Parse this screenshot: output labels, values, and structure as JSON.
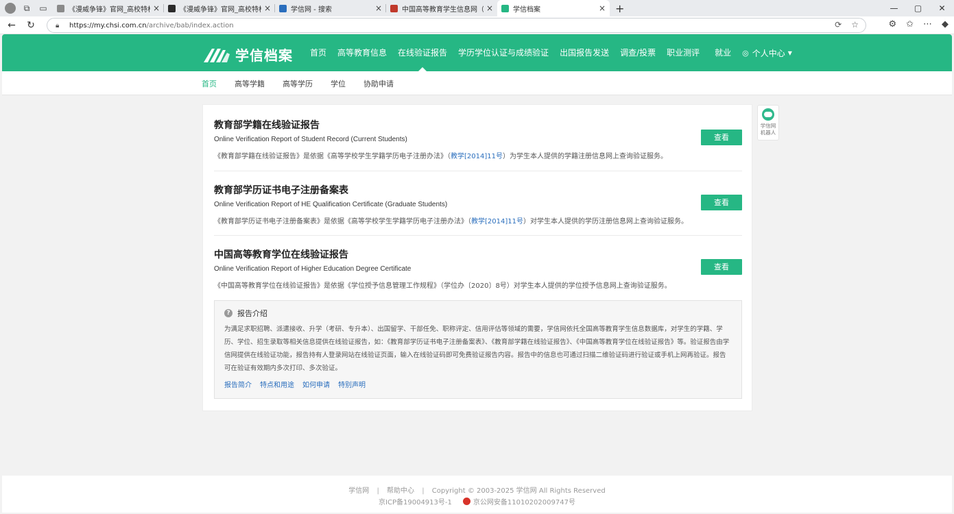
{
  "browser": {
    "tabs": [
      {
        "title": "《漫威争锋》官网_高校特权_漫威",
        "favicon_color": "#8a8a8a"
      },
      {
        "title": "《漫威争锋》官网_高校特权_漫威",
        "favicon_color": "#2b2b2b"
      },
      {
        "title": "学信网 - 搜索",
        "favicon_color": "#2a6ebd"
      },
      {
        "title": "中国高等教育学生信息网（学信网）",
        "favicon_color": "#c0392b"
      },
      {
        "title": "学信档案",
        "favicon_color": "#26b784",
        "active": true
      }
    ],
    "url_host": "https://my.chsi.com.cn",
    "url_path": "/archive/bab/index.action"
  },
  "site": {
    "logo_text": "学信档案",
    "brand_color": "#26b784",
    "nav": [
      {
        "label": "首页"
      },
      {
        "label": "高等教育信息"
      },
      {
        "label": "在线验证报告",
        "active": true
      },
      {
        "label": "学历学位认证与成绩验证"
      },
      {
        "label": "出国报告发送"
      },
      {
        "label": "调查/投票"
      },
      {
        "label": "职业测评"
      },
      {
        "label": "就业"
      }
    ],
    "user_menu": "个人中心"
  },
  "subnav": [
    {
      "label": "首页",
      "active": true
    },
    {
      "label": "高等学籍"
    },
    {
      "label": "高等学历"
    },
    {
      "label": "学位"
    },
    {
      "label": "协助申请"
    }
  ],
  "reports": [
    {
      "title": "教育部学籍在线验证报告",
      "en": "Online Verification Report of Student Record (Current Students)",
      "desc_pre": "《教育部学籍在线验证报告》是依据《高等学校学生学籍学历电子注册办法》（",
      "desc_link": "教学[2014]11号",
      "desc_post": "）为学生本人提供的学籍注册信息网上查询验证服务。",
      "button": "查看"
    },
    {
      "title": "教育部学历证书电子注册备案表",
      "en": "Online Verification Report of HE Qualification Certificate (Graduate Students)",
      "desc_pre": "《教育部学历证书电子注册备案表》是依据《高等学校学生学籍学历电子注册办法》（",
      "desc_link": "教学[2014]11号",
      "desc_post": "）对学生本人提供的学历注册信息网上查询验证服务。",
      "button": "查看"
    },
    {
      "title": "中国高等教育学位在线验证报告",
      "en": "Online Verification Report of Higher Education Degree Certificate",
      "desc_pre": "《中国高等教育学位在线验证报告》是依据《学位授予信息管理工作规程》（学位办〔2020〕8号）对学生本人提供的学位授予信息网上查询验证服务。",
      "desc_link": "",
      "desc_post": "",
      "button": "查看"
    }
  ],
  "intro": {
    "title": "报告介绍",
    "body": "为满足求职招聘、派遣接收、升学（考研、专升本）、出国留学、干部任免、职称评定、信用评估等领域的需要，学信网依托全国高等教育学生信息数据库，对学生的学籍、学历、学位、招生录取等相关信息提供在线验证报告，如：《教育部学历证书电子注册备案表》、《教育部学籍在线验证报告》、《中国高等教育学位在线验证报告》等。验证报告由学信网提供在线验证功能，报告持有人登录网站在线验证页面，输入在线验证码即可免费验证报告内容。报告中的信息也可通过扫描二维验证码进行验证或手机上网再验证。报告可在验证有效期内多次打印、多次验证。",
    "links": [
      "报告简介",
      "特点和用途",
      "如何申请",
      "特别声明"
    ]
  },
  "robot": {
    "label_line1": "学信网",
    "label_line2": "机器人"
  },
  "footer": {
    "link1": "学信网",
    "link2": "帮助中心",
    "copyright": "Copyright © 2003-2025 学信网 All Rights Reserved",
    "icp": "京ICP备19004913号-1",
    "police": "京公网安备11010202009747号"
  }
}
